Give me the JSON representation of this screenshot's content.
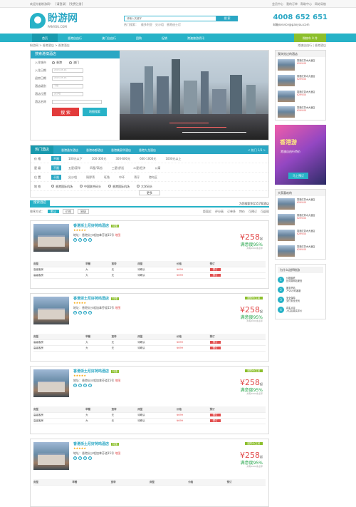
{
  "topbar": {
    "left": [
      "欢迎光临盼游网！",
      "[请登录]",
      "[免费注册]"
    ],
    "right": [
      "会员中心",
      "我的订单",
      "帮助中心",
      "网站导航"
    ]
  },
  "header": {
    "logo_title": "盼游网",
    "logo_sub": "PANYOU.COM",
    "search_placeholder": "请输入关键字",
    "search_button": "搜 索",
    "hot_words": [
      "热门搜索：",
      "维多利亚",
      "尖沙咀",
      "香港迪士尼"
    ],
    "phone": "4008 652 651",
    "email": "邮箱service@panyou.com"
  },
  "nav": {
    "items": [
      "首页",
      "香港自由行",
      "澳门自由行",
      "团购",
      "促销",
      "港澳旅游资讯"
    ],
    "active": 0,
    "cart": "购物车 0 件"
  },
  "breadcrumb": {
    "left": "盼游网 > 香港酒店 > 香港酒店",
    "right": "港澳自由行 | 香港酒店"
  },
  "search_form": {
    "title": "搜索港澳酒店",
    "rows": [
      {
        "label": "入住城市",
        "value": "香港",
        "alt": "澳门"
      },
      {
        "label": "入住日期",
        "value": "2013-05-16"
      },
      {
        "label": "退房日期",
        "value": "2013-05-18"
      },
      {
        "label": "酒店级别",
        "value": "不限"
      },
      {
        "label": "酒店位置",
        "value": "尖沙咀"
      },
      {
        "label": "酒店名称",
        "value": ""
      }
    ],
    "search_btn": "搜 索",
    "map_btn": "地图搜索"
  },
  "filter": {
    "tab": "热门酒店",
    "hotels": [
      "香港逸东酒店",
      "香港帝都酒店",
      "香港美丽华酒店",
      "香港九龙酒店"
    ],
    "pager": "< 热门 1/3 >",
    "rows": [
      {
        "label": "价 格",
        "chips": [
          "不限",
          "100元以下",
          "100-300元",
          "300-600元",
          "600-1000元",
          "1000元以上"
        ],
        "active": 0
      },
      {
        "label": "星 级",
        "chips": [
          "不限",
          "五星/豪华",
          "四星/高档",
          "三星/舒适",
          "二星/经济",
          "公寓"
        ],
        "active": 0
      },
      {
        "label": "位 置",
        "chips": [
          "不限",
          "尖沙咀",
          "铜锣湾",
          "旺角",
          "中环",
          "湾仔",
          "港岛区"
        ],
        "active": 0
      },
      {
        "label": "地 铁",
        "chips": [
          "香港国际机场",
          "中国联合码头",
          "香港国际机场",
          "大学码头"
        ],
        "active": 0
      }
    ],
    "more": "更多"
  },
  "list": {
    "title": "搜索酒店",
    "sort_label": "排序方式：",
    "sorts": [
      "默认",
      "价格",
      "星级"
    ],
    "right_opts": [
      "距离近",
      "评分高",
      "订单多",
      "特价",
      "可预订",
      "可返现"
    ],
    "count": "为您搜索到1557家酒店"
  },
  "hotels": [
    {
      "name": "香港浙土尼好苑鸣酒店",
      "tag": "特惠",
      "address": "地址：香港尖沙咀加拿芬道15号",
      "map": "地图",
      "promo": "",
      "price": "¥258",
      "price_sub": "起",
      "rate": "满意度95%",
      "rate_sub": "共有2000条点评",
      "table": {
        "headers": [
          "房型",
          "早餐",
          "宽带",
          "床型",
          "价格",
          "预订"
        ],
        "rows": [
          [
            "高级客房",
            "大",
            "无",
            "待确认",
            "¥699",
            "预订"
          ],
          [
            "高级客房",
            "大",
            "无",
            "待确认",
            "¥699",
            "预订"
          ]
        ]
      }
    },
    {
      "name": "香港浙土尼好苑鸣酒店",
      "tag": "特惠",
      "address": "地址：香港尖沙咀加拿芬道15号",
      "map": "地图",
      "promo": "团购价立减",
      "price": "¥258",
      "price_sub": "起",
      "rate": "满意度95%",
      "rate_sub": "共有2000条点评",
      "table": {
        "headers": [
          "房型",
          "早餐",
          "宽带",
          "床型",
          "价格",
          "预订"
        ],
        "rows": [
          [
            "高级客房",
            "大",
            "无",
            "待确认",
            "¥699",
            "预订"
          ],
          [
            "高级客房",
            "大",
            "无",
            "待确认",
            "¥699",
            "预订"
          ]
        ]
      }
    },
    {
      "name": "香港浙土尼好苑鸣酒店",
      "tag": "特惠",
      "address": "地址：香港尖沙咀加拿芬道15号",
      "map": "地图",
      "promo": "团购价立减",
      "price": "¥258",
      "price_sub": "起",
      "rate": "满意度95%",
      "rate_sub": "共有2000条点评",
      "table": {
        "headers": [
          "房型",
          "早餐",
          "宽带",
          "床型",
          "价格",
          "预订"
        ],
        "rows": [
          [
            "高级客房",
            "大",
            "无",
            "待确认",
            "¥699",
            "预订"
          ],
          [
            "高级客房",
            "大",
            "无",
            "待确认",
            "¥699",
            "预订"
          ]
        ]
      }
    },
    {
      "name": "香港浙土尼好苑鸣酒店",
      "tag": "特惠",
      "address": "地址：香港尖沙咀加拿芬道15号",
      "map": "地图",
      "promo": "团购价立减",
      "price": "¥258",
      "price_sub": "起",
      "rate": "满意度95%",
      "rate_sub": "共有2000条点评",
      "table": {
        "headers": [
          "房型",
          "早餐",
          "宽带",
          "床型",
          "价格",
          "预订"
        ],
        "rows": []
      }
    }
  ],
  "sidebar": {
    "recent_title": "我浏览过的酒店",
    "recent": [
      {
        "name": "香港红茶木大酒店",
        "price": "¥299.00"
      },
      {
        "name": "香港红茶木大酒店",
        "price": "¥299.00"
      },
      {
        "name": "香港红茶木大酒店",
        "price": "¥299.00"
      },
      {
        "name": "香港红茶木大酒店",
        "price": "¥299.00"
      }
    ],
    "ad": {
      "title": "香港游",
      "sub": "港澳自由行特价",
      "btn": "马上预订"
    },
    "like_title": "大家喜欢的",
    "likes": [
      {
        "name": "香港红茶木大酒店",
        "price": "¥299.00"
      },
      {
        "name": "香港红茶木大酒店",
        "price": "¥299.00"
      },
      {
        "name": "香港红茶木大酒店",
        "price": "¥299.00"
      },
      {
        "name": "香港红茶木大酒店",
        "price": "¥299.00"
      }
    ],
    "why_title": "为什么选择盼游",
    "why": [
      {
        "n": "1",
        "t": "价格最低",
        "d": "比同类网站便宜"
      },
      {
        "n": "2",
        "t": "服务热情",
        "d": "7*24小时客服"
      },
      {
        "n": "3",
        "t": "安全保障",
        "d": "支付安全无忧"
      },
      {
        "n": "4",
        "t": "真实点评",
        "d": "入住后真实评价"
      }
    ]
  }
}
